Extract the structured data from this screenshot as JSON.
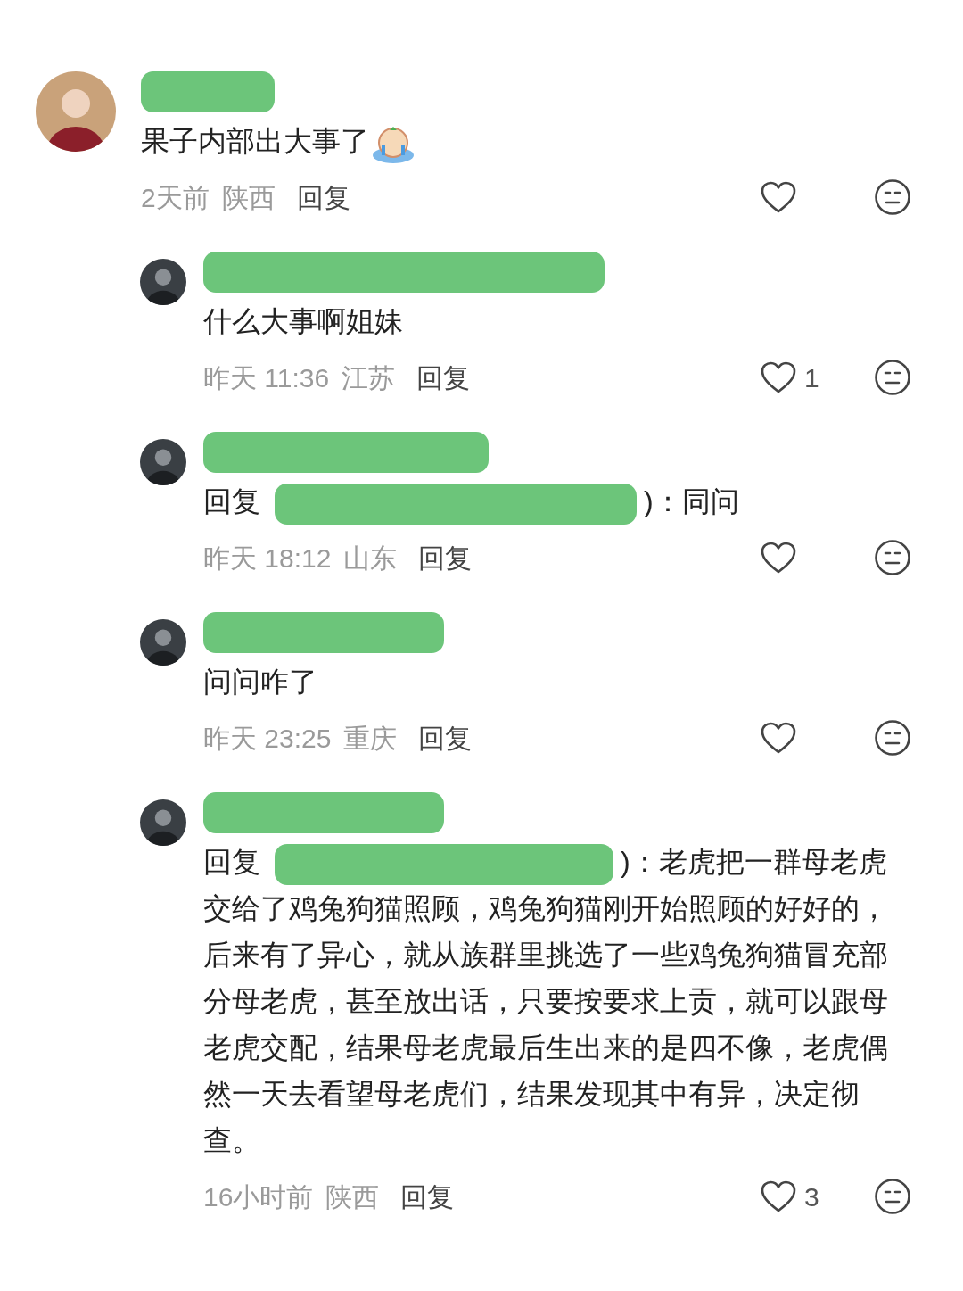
{
  "comments": [
    {
      "kind": "top",
      "text": "果子内部出大事了",
      "trailing_emoji": true,
      "time": "2天前",
      "location": "陕西",
      "reply_label": "回复"
    },
    {
      "kind": "reply",
      "text": "什么大事啊姐妹",
      "time": "昨天 11:36",
      "location": "江苏",
      "reply_label": "回复",
      "likes": "1"
    },
    {
      "kind": "reply",
      "reply_prefix": "回复",
      "text": ")：同问",
      "time": "昨天 18:12",
      "location": "山东",
      "reply_label": "回复"
    },
    {
      "kind": "reply",
      "text": "问问咋了",
      "time": "昨天 23:25",
      "location": "重庆",
      "reply_label": "回复"
    },
    {
      "kind": "reply",
      "reply_prefix": "回复",
      "text": ")：老虎把一群母老虎交给了鸡兔狗猫照顾，鸡兔狗猫刚开始照顾的好好的，后来有了异心，就从族群里挑选了一些鸡兔狗猫冒充部分母老虎，甚至放出话，只要按要求上贡，就可以跟母老虎交配，结果母老虎最后生出来的是四不像，老虎偶然一天去看望母老虎们，结果发现其中有异，决定彻查。",
      "time": "16小时前",
      "location": "陕西",
      "reply_label": "回复",
      "likes": "3"
    }
  ]
}
